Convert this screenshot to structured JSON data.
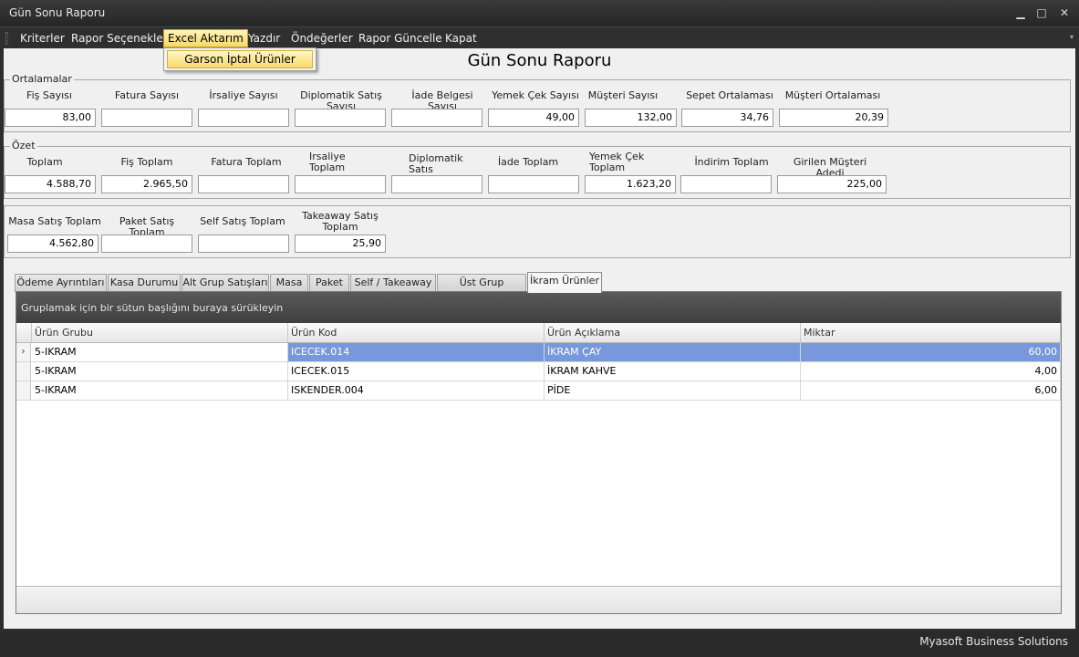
{
  "window": {
    "title": "Gün Sonu Raporu",
    "minimize_glyph": "▁",
    "maximize_glyph": "□",
    "close_glyph": "✕"
  },
  "menu": {
    "items": [
      "Kriterler",
      "Rapor Seçenekleri",
      "Excel Aktarım",
      "Yazdır",
      "Öndeğerler",
      "Rapor Güncelle",
      "Kapat"
    ],
    "active_item": "Excel Aktarım",
    "dropdown": [
      "Garson İptal Ürünler"
    ],
    "overflow_glyph": "▾"
  },
  "report": {
    "title": "Gün Sonu Raporu"
  },
  "averages": {
    "legend": "Ortalamalar",
    "fields": [
      {
        "label": "Fiş Sayısı",
        "value": "83,00"
      },
      {
        "label": "Fatura Sayısı",
        "value": ""
      },
      {
        "label": "İrsaliye Sayısı",
        "value": ""
      },
      {
        "label": "Diplomatik Satış Sayısı",
        "value": ""
      },
      {
        "label": "İade Belgesi Sayısı",
        "value": ""
      },
      {
        "label": "Yemek Çek Sayısı",
        "value": "49,00"
      },
      {
        "label": "Müşteri Sayısı",
        "value": "132,00"
      },
      {
        "label": "Sepet Ortalaması",
        "value": "34,76"
      },
      {
        "label": "Müşteri Ortalaması",
        "value": "20,39"
      }
    ]
  },
  "summary": {
    "legend": "Özet",
    "fields": [
      {
        "label": "Toplam",
        "value": "4.588,70"
      },
      {
        "label": "Fiş Toplam",
        "value": "2.965,50"
      },
      {
        "label": "Fatura Toplam",
        "value": ""
      },
      {
        "label": "Irsaliye\nToplam",
        "value": ""
      },
      {
        "label": "Diplomatik\nSatıs",
        "value": ""
      },
      {
        "label": "İade Toplam",
        "value": ""
      },
      {
        "label": "Yemek Çek\nToplam",
        "value": "1.623,20"
      },
      {
        "label": "İndirim Toplam",
        "value": ""
      },
      {
        "label": "Girilen Müşteri Adedi",
        "value": "225,00"
      }
    ]
  },
  "sales": {
    "fields": [
      {
        "label": "Masa Satış Toplam",
        "value": "4.562,80"
      },
      {
        "label": "Paket Satış Toplam",
        "value": ""
      },
      {
        "label": "Self Satış Toplam",
        "value": ""
      },
      {
        "label": "Takeaway Satış\nToplam",
        "value": "25,90"
      }
    ]
  },
  "tabs": {
    "items": [
      "Ödeme Ayrıntıları",
      "Kasa Durumu",
      "Alt Grup Satışları",
      "Masa",
      "Paket",
      "Self / Takeaway",
      "Üst Grup Satışları",
      "İkram Ürünler"
    ],
    "selected": "İkram Ürünler"
  },
  "grid": {
    "group_hint": "Gruplamak için bir sütun başlığını buraya sürükleyin",
    "columns": [
      "Ürün Grubu",
      "Ürün Kod",
      "Ürün Açıklama",
      "Miktar"
    ],
    "rows": [
      {
        "group": "5-IKRAM",
        "code": "ICECEK.014",
        "desc": "İKRAM ÇAY",
        "qty": "60,00"
      },
      {
        "group": "5-IKRAM",
        "code": "ICECEK.015",
        "desc": "İKRAM KAHVE",
        "qty": "4,00"
      },
      {
        "group": "5-IKRAM",
        "code": "ISKENDER.004",
        "desc": "PİDE",
        "qty": "6,00"
      }
    ],
    "selected_row": 0,
    "row_indicator": "›"
  },
  "status": {
    "text": "Myasoft Business Solutions"
  }
}
